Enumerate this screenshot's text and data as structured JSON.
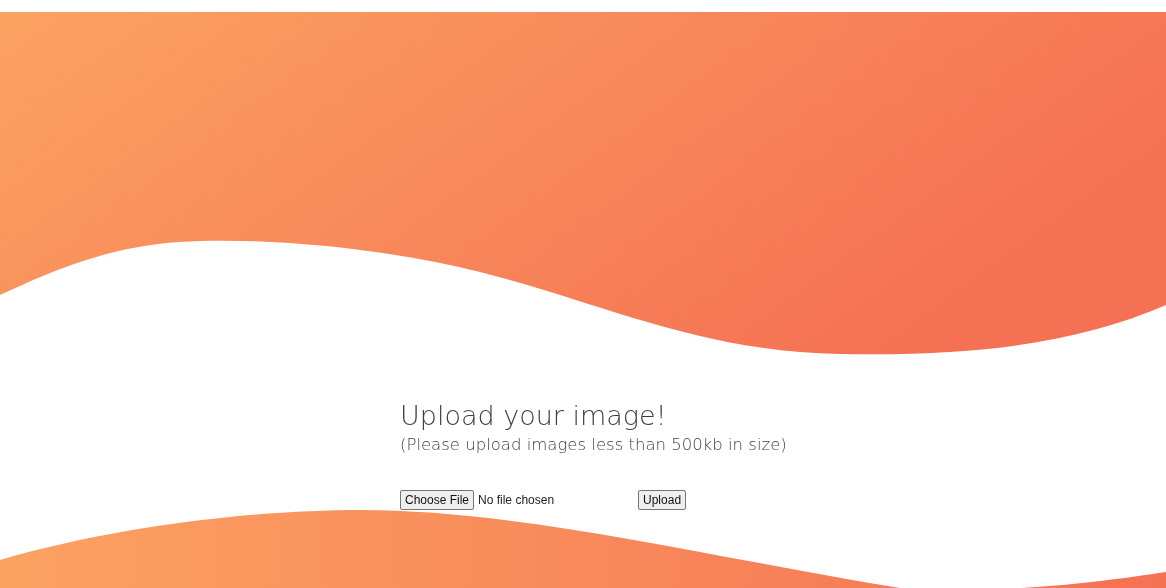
{
  "heading": "Upload your image!",
  "subheading": "(Please upload images less than 500kb in size)",
  "file_picker": {
    "button": "Choose File",
    "status": "No file chosen"
  },
  "submit_button": "Upload"
}
